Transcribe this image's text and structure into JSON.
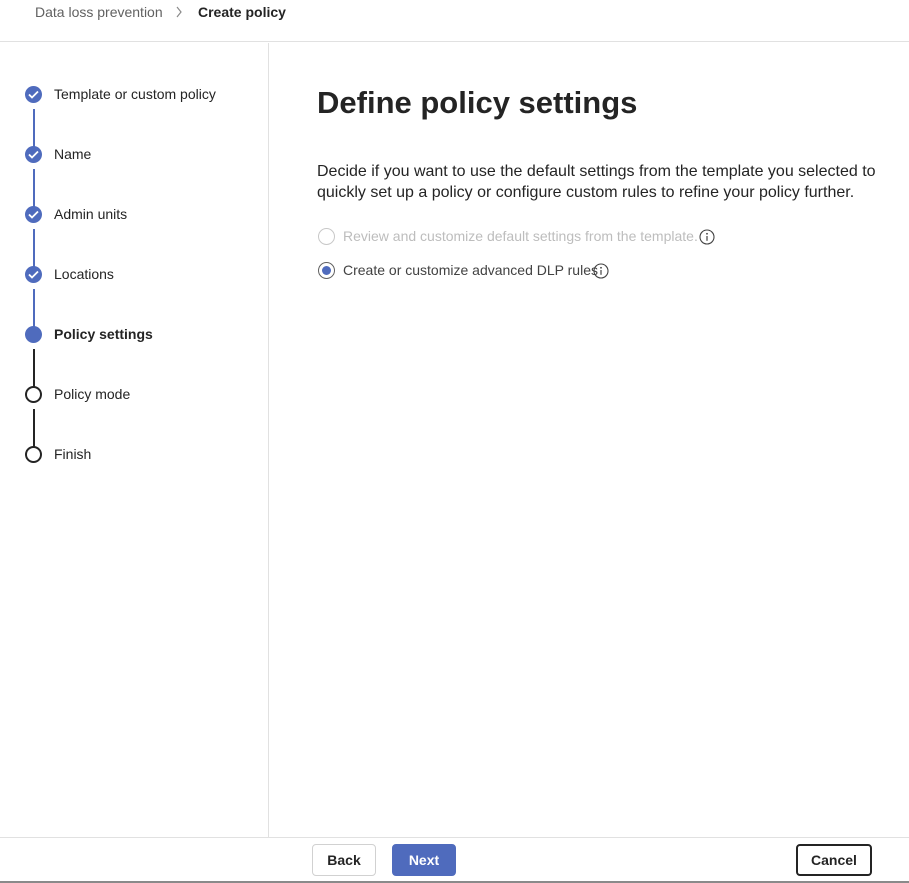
{
  "breadcrumb": {
    "parent": "Data loss prevention",
    "separator_icon": "chevron-right-icon",
    "current": "Create policy"
  },
  "steps": [
    {
      "label": "Template or custom policy",
      "status": "completed"
    },
    {
      "label": "Name",
      "status": "completed"
    },
    {
      "label": "Admin units",
      "status": "completed"
    },
    {
      "label": "Locations",
      "status": "completed"
    },
    {
      "label": "Policy settings",
      "status": "current"
    },
    {
      "label": "Policy mode",
      "status": "not-started"
    },
    {
      "label": "Finish",
      "status": "not-started"
    }
  ],
  "main": {
    "title": "Define policy settings",
    "description": "Decide if you want to use the default settings from the template you selected to quickly set up a policy or configure custom rules to refine your policy further.",
    "options": [
      {
        "label": "Review and customize default settings from the template.",
        "selected": false,
        "disabled": true,
        "icon": "info-icon"
      },
      {
        "label": "Create or customize advanced DLP rules",
        "selected": true,
        "disabled": false,
        "icon": "info-icon"
      }
    ]
  },
  "footer": {
    "back_label": "Back",
    "next_label": "Next",
    "cancel_label": "Cancel"
  },
  "colors": {
    "accent": "#4f6bbd",
    "text": "#242424",
    "disabled_text": "#bdbdbd",
    "divider": "#e1e1e1"
  }
}
